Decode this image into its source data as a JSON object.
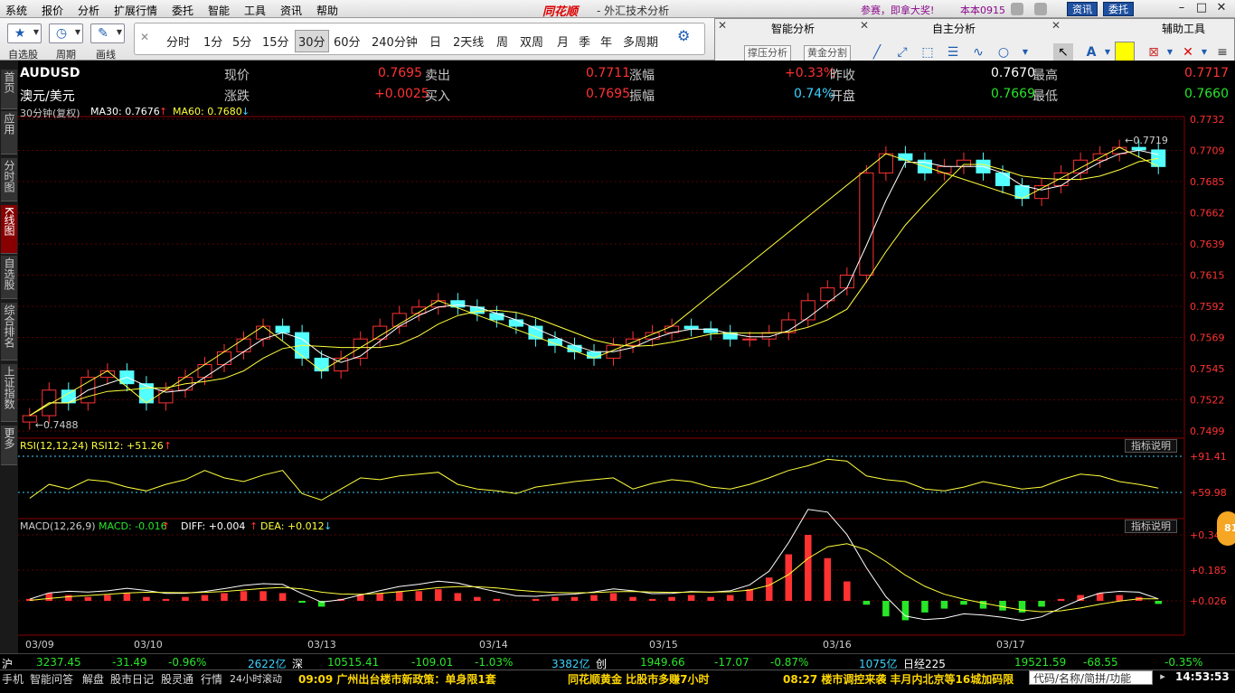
{
  "menu": {
    "items": [
      "系统",
      "报价",
      "分析",
      "扩展行情",
      "委托",
      "智能",
      "工具",
      "资讯",
      "帮助"
    ],
    "brand": "同花顺",
    "app_title": "- 外汇技术分析",
    "promo": "参赛，即拿大奖!",
    "account": "本本0915",
    "btn_news": "资讯",
    "btn_trade": "委托"
  },
  "toolbar": {
    "self_select": "自选股",
    "period": "周期",
    "draw": "画线",
    "periods": [
      "分时",
      "1分",
      "5分",
      "15分",
      "30分",
      "60分",
      "240分钟",
      "日",
      "2天线",
      "周",
      "双周",
      "月",
      "季",
      "年",
      "多周期"
    ],
    "selected_period": "30分"
  },
  "tool_panel": {
    "smart": "智能分析",
    "self": "自主分析",
    "aux": "辅助工具",
    "btn_support": "撑压分析",
    "btn_golden": "黄金分割"
  },
  "sidebar": [
    "首页",
    "应用",
    "分时图",
    "K线图",
    "自选股",
    "综合排名",
    "上证指数",
    "更多"
  ],
  "quote": {
    "symbol": "AUDUSD",
    "name": "澳元/美元",
    "l_now": "现价",
    "v_now": "0.7695",
    "l_chg": "涨跌",
    "v_chg": "+0.0025",
    "l_sell": "卖出",
    "v_sell": "0.7711",
    "l_buy": "买入",
    "v_buy": "0.7695",
    "l_pct": "涨幅",
    "v_pct": "+0.33%",
    "l_amp": "振幅",
    "v_amp": "0.74%",
    "l_prev": "昨收",
    "v_prev": "0.7670",
    "l_open": "开盘",
    "v_open": "0.7669",
    "l_high": "最高",
    "v_high": "0.7717",
    "l_low": "最低",
    "v_low": "0.7660"
  },
  "indicators": {
    "ma_header": "30分钟(复权)",
    "ma30": "MA30: 0.7676",
    "ma60": "MA60: 0.7680",
    "rsi": "RSI(12,12,24)  RSI12: +51.26",
    "macd_label": "MACD(12,26,9)",
    "macd": "MACD: -0.016",
    "diff": "DIFF: +0.004",
    "dea": "DEA: +0.012",
    "explain": "指标说明"
  },
  "chart_data": {
    "type": "candlestick",
    "price_axis": [
      "0.7732",
      "0.7709",
      "0.7685",
      "0.7662",
      "0.7639",
      "0.7615",
      "0.7592",
      "0.7569",
      "0.7545",
      "0.7522",
      "0.7499"
    ],
    "high_label": "0.7719",
    "low_label": "0.7488",
    "rsi_axis": [
      "+91.41",
      "+59.98"
    ],
    "macd_axis": [
      "+0.340",
      "+0.185",
      "+0.026"
    ],
    "dates": [
      "03/09",
      "03/10",
      "03/13",
      "03/14",
      "03/15",
      "03/16",
      "03/17"
    ],
    "ylim": [
      0.7488,
      0.7732
    ],
    "close": [
      0.75,
      0.752,
      0.751,
      0.753,
      0.7535,
      0.7525,
      0.751,
      0.752,
      0.753,
      0.754,
      0.755,
      0.756,
      0.757,
      0.7565,
      0.7545,
      0.7535,
      0.7545,
      0.756,
      0.757,
      0.758,
      0.7585,
      0.759,
      0.7585,
      0.758,
      0.7575,
      0.757,
      0.756,
      0.7555,
      0.755,
      0.7545,
      0.7555,
      0.756,
      0.7565,
      0.757,
      0.7568,
      0.7565,
      0.756,
      0.756,
      0.7565,
      0.7575,
      0.759,
      0.76,
      0.761,
      0.769,
      0.7705,
      0.77,
      0.769,
      0.7695,
      0.77,
      0.769,
      0.768,
      0.767,
      0.768,
      0.769,
      0.77,
      0.7705,
      0.771,
      0.7708,
      0.7695
    ],
    "rsi_values": [
      40,
      55,
      50,
      60,
      58,
      52,
      48,
      55,
      60,
      70,
      62,
      58,
      65,
      70,
      45,
      38,
      50,
      62,
      60,
      64,
      66,
      68,
      55,
      50,
      48,
      45,
      52,
      55,
      58,
      60,
      62,
      50,
      56,
      60,
      58,
      52,
      50,
      55,
      62,
      70,
      75,
      82,
      80,
      64,
      60,
      58,
      50,
      48,
      52,
      58,
      54,
      50,
      52,
      60,
      66,
      64,
      58,
      55,
      51
    ],
    "macd_values": [
      0.01,
      0.04,
      0.03,
      0.02,
      0.03,
      0.04,
      0.02,
      0.01,
      0.02,
      0.03,
      0.04,
      0.05,
      0.05,
      0.04,
      -0.01,
      -0.03,
      0.01,
      0.03,
      0.04,
      0.05,
      0.05,
      0.06,
      0.04,
      0.02,
      0.01,
      0.0,
      0.01,
      0.02,
      0.02,
      0.03,
      0.04,
      0.02,
      0.01,
      0.02,
      0.03,
      0.02,
      0.03,
      0.06,
      0.12,
      0.24,
      0.34,
      0.22,
      0.1,
      -0.02,
      -0.08,
      -0.1,
      -0.06,
      -0.04,
      -0.02,
      -0.04,
      -0.05,
      -0.06,
      -0.03,
      0.01,
      0.03,
      0.04,
      0.03,
      0.02,
      -0.016
    ]
  },
  "index_bar": {
    "sh": "沪",
    "sh_val": "3237.45",
    "sh_chg": "-31.49",
    "sh_pct": "-0.96%",
    "sh_amt": "2622亿",
    "sz": "深",
    "sz_val": "10515.41",
    "sz_chg": "-109.01",
    "sz_pct": "-1.03%",
    "sz_amt": "3382亿",
    "cy": "创",
    "cy_val": "1949.66",
    "cy_chg": "-17.07",
    "cy_pct": "-0.87%",
    "cy_amt": "1075亿",
    "nk": "日经225",
    "nk_val": "19521.59",
    "nk_chg": "-68.55",
    "nk_pct": "-0.35%"
  },
  "status": {
    "tabs": [
      "手机",
      "智能问答",
      "解盘",
      "股市日记",
      "股灵通",
      "行情",
      "24小时滚动"
    ],
    "news1": "09:09 广州出台楼市新政策：单身限1套",
    "news2": "同花顺黄金 比股市多赚7小时",
    "news3": "08:27 楼市调控来袭  丰月内北京等16城加码限",
    "search_placeholder": "代码/名称/简拼/功能",
    "clock": "14:53:53",
    "badge": "81"
  }
}
